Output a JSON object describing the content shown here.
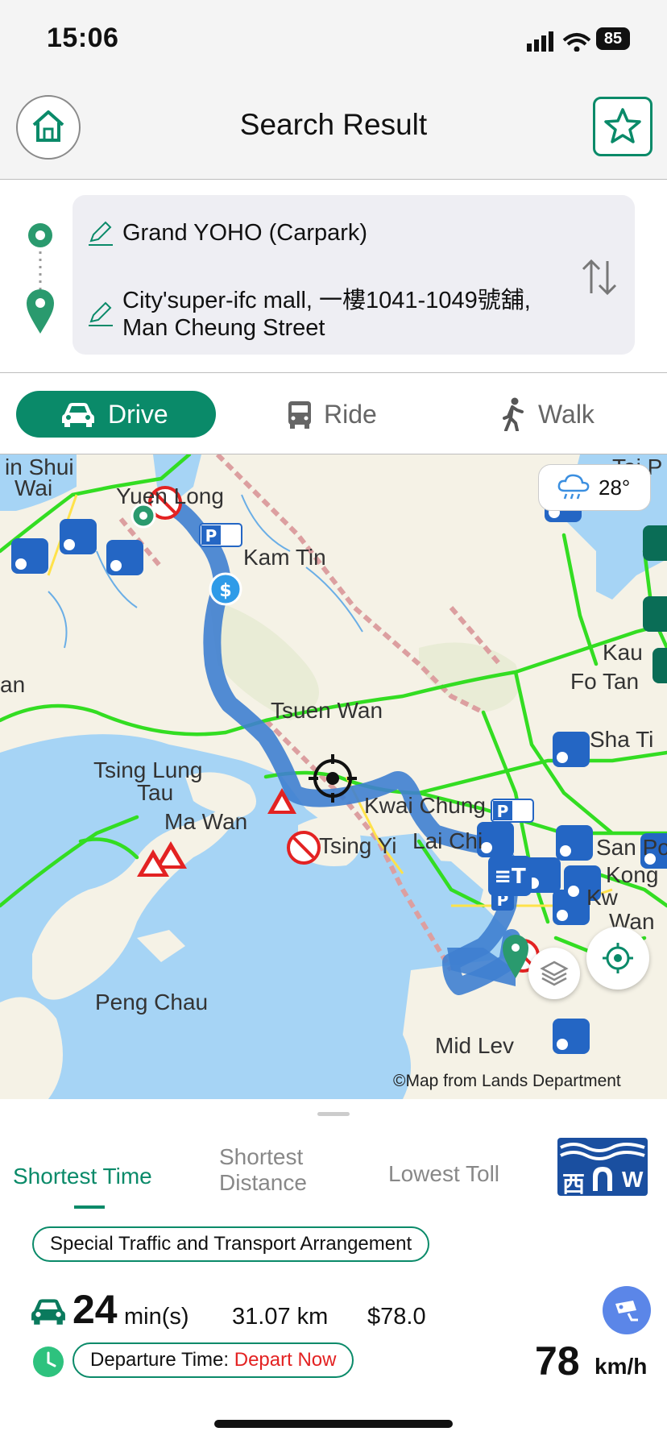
{
  "status_bar": {
    "time": "15:06",
    "battery": "85"
  },
  "header": {
    "title": "Search Result"
  },
  "route": {
    "origin": "Grand YOHO (Carpark)",
    "destination_line1": "City'super-ifc mall, 一樓1041-1049號舖,",
    "destination_line2": "Man Cheung Street"
  },
  "modes": {
    "drive": "Drive",
    "ride": "Ride",
    "walk": "Walk"
  },
  "map": {
    "places": {
      "tin_shui_wai_1": "in Shui",
      "tin_shui_wai_2": "Wai",
      "yuen_long": "Yuen Long",
      "kam_tin": "Kam Tin",
      "tsuen_wan": "Tsuen Wan",
      "tsing_lung_tau_1": "Tsing Lung",
      "tsing_lung_tau_2": "Tau",
      "ma_wan": "Ma Wan",
      "kwai_chung": "Kwai Chung",
      "lai_chi": "Lai Chi",
      "peng_chau": "Peng Chau",
      "kau": "Kau",
      "fo_tan": "Fo Tan",
      "sha_ti": "Sha Ti",
      "san_po": "San Po",
      "kong": "Kong",
      "kw": "Kw",
      "wan": "Wan",
      "mid_lev": "Mid Lev",
      "lan": "an",
      "tai": "Tai P",
      "tsing_yi": "Tsing Yi"
    },
    "weather_temp": "28°",
    "copyright": "©Map from Lands Department"
  },
  "options": {
    "shortest_time": "Shortest Time",
    "shortest_distance_1": "Shortest",
    "shortest_distance_2": "Distance",
    "lowest_toll": "Lowest Toll",
    "tunnel_badge": "西",
    "tunnel_badge_w": "W"
  },
  "summary": {
    "special_label": "Special Traffic and Transport Arrangement",
    "duration": "24",
    "duration_unit": "min(s)",
    "distance": "31.07 km",
    "toll": "$78.0",
    "departure_label": "Departure Time: ",
    "departure_value": "Depart Now",
    "speed": "78",
    "speed_unit": "km/h"
  },
  "colors": {
    "brand": "#0a8a69",
    "route": "#3f7fd0",
    "sea": "#a6d4f5",
    "land": "#f5f2e6",
    "traffic_green": "#33dd22",
    "alert_red": "#e32222"
  }
}
